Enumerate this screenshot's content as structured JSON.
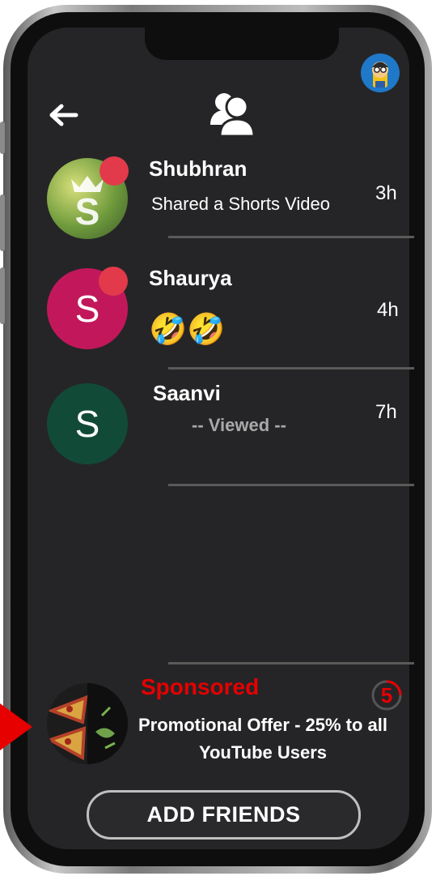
{
  "header": {
    "back_icon": "arrow-left-icon",
    "friends_icon": "people-icon",
    "profile_icon": "avatar-cartoon-icon"
  },
  "chats": [
    {
      "name": "Shubhran",
      "message": "Shared a Shorts Video",
      "time": "3h",
      "avatar_letter": "",
      "avatar_kind": "logo-image",
      "unread": true
    },
    {
      "name": "Shaurya",
      "message": "🤣🤣",
      "time": "4h",
      "avatar_letter": "S",
      "avatar_color": "#c2185b",
      "unread": true
    },
    {
      "name": "Saanvi",
      "message": "-- Viewed --",
      "time": "7h",
      "avatar_letter": "S",
      "avatar_color": "#124a38",
      "unread": false
    }
  ],
  "sponsored": {
    "label": "Sponsored",
    "text": "Promotional Offer - 25% to all YouTube Users",
    "countdown": "5",
    "thumbnail": "pizza-image"
  },
  "actions": {
    "add_friends_label": "ADD FRIENDS"
  },
  "colors": {
    "background": "#252527",
    "badge": "#e23a4a",
    "sponsored": "#e60000",
    "accent_pointer": "#e60000"
  }
}
